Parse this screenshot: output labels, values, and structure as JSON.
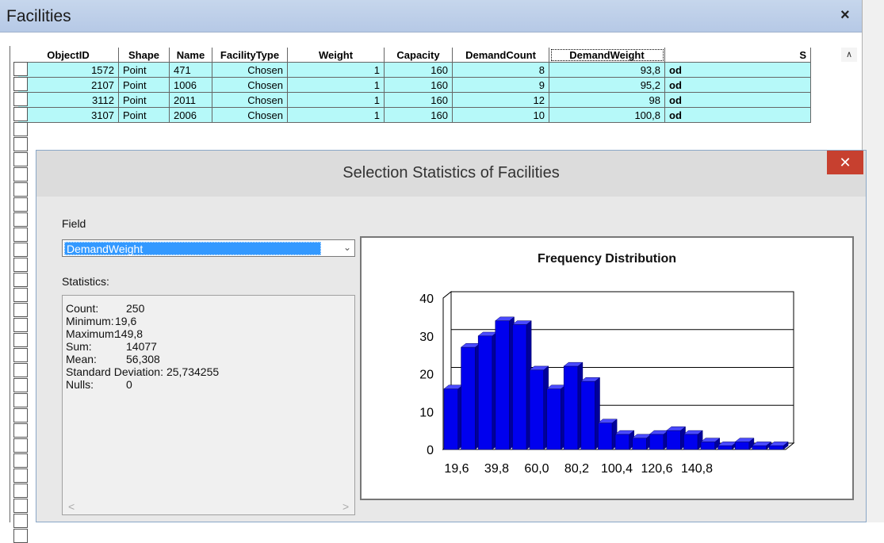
{
  "table_window": {
    "title": "Facilities",
    "close_glyph": "×",
    "columns": [
      "ObjectID",
      "Shape",
      "Name",
      "FacilityType",
      "Weight",
      "Capacity",
      "DemandCount",
      "DemandWeight",
      "S"
    ],
    "rows": [
      [
        "1572",
        "Point",
        "471",
        "Chosen",
        "1",
        "160",
        "8",
        "93,8",
        "od"
      ],
      [
        "2107",
        "Point",
        "1006",
        "Chosen",
        "1",
        "160",
        "9",
        "95,2",
        "od"
      ],
      [
        "3112",
        "Point",
        "2011",
        "Chosen",
        "1",
        "160",
        "12",
        "98",
        "od"
      ],
      [
        "3107",
        "Point",
        "2006",
        "Chosen",
        "1",
        "160",
        "10",
        "100,8",
        "od"
      ]
    ]
  },
  "dialog": {
    "title": "Selection Statistics of Facilities",
    "close_glyph": "✕",
    "field_label": "Field",
    "field_value": "DemandWeight",
    "statistics_label": "Statistics:",
    "stats": [
      {
        "label": "Count:",
        "value": "250"
      },
      {
        "label": "Minimum:",
        "value": "19,6"
      },
      {
        "label": "Maximum:",
        "value": "149,8"
      },
      {
        "label": "Sum:",
        "value": "14077"
      },
      {
        "label": "Mean:",
        "value": "56,308"
      },
      {
        "label": "Standard Deviation:",
        "value": "25,734255"
      },
      {
        "label": "Nulls:",
        "value": "0"
      }
    ],
    "scroll_left": "<",
    "scroll_right": ">"
  },
  "chart_data": {
    "type": "bar",
    "title": "Frequency Distribution",
    "xlabel": "",
    "ylabel": "",
    "ylim": [
      0,
      40
    ],
    "yticks": [
      "0",
      "10",
      "20",
      "30",
      "40"
    ],
    "xticks": [
      "19,6",
      "39,8",
      "60,0",
      "80,2",
      "100,4",
      "120,6",
      "140,8"
    ],
    "values": [
      16,
      27,
      30,
      34,
      33,
      21,
      16,
      22,
      18,
      7,
      4,
      3,
      4,
      5,
      4,
      2,
      1,
      2,
      1,
      1
    ],
    "colors": {
      "bar": "#0000ee",
      "bar_side": "#00009a",
      "bar_top": "#4a4aff"
    }
  }
}
